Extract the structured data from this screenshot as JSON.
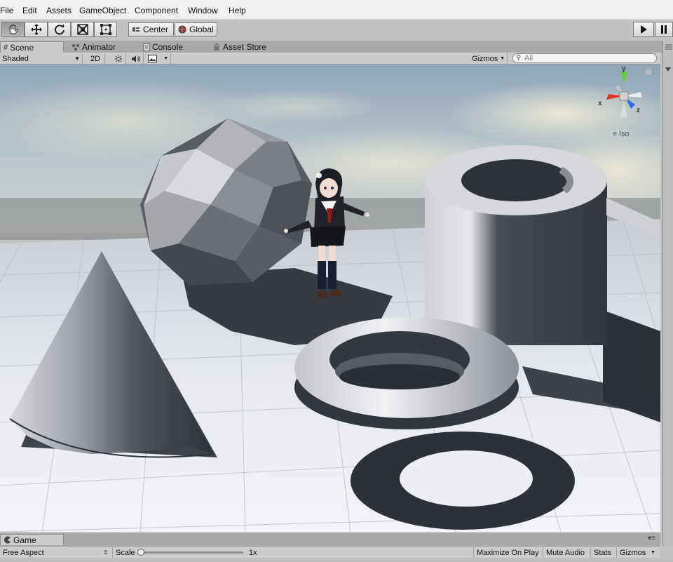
{
  "menu": [
    "File",
    "Edit",
    "Assets",
    "GameObject",
    "Component",
    "Window",
    "Help"
  ],
  "toolbar": {
    "tools": [
      "hand-tool",
      "move-tool",
      "rotate-tool",
      "scale-tool",
      "rect-tool"
    ],
    "pivot_label": "Center",
    "space_label": "Global"
  },
  "tabs": {
    "scene": "Scene",
    "animator": "Animator",
    "console": "Console",
    "asset_store": "Asset Store"
  },
  "scene_toolbar": {
    "draw_mode": "Shaded",
    "mode_2d": "2D",
    "gizmos": "Gizmos",
    "search_placeholder": "All"
  },
  "gizmo": {
    "y_label": "y",
    "x_label": "x",
    "z_label": "z",
    "projection": "Iso"
  },
  "game_panel": {
    "tab": "Game",
    "aspect": "Free Aspect",
    "scale_label": "Scale",
    "scale_value": "1x",
    "maximize": "Maximize On Play",
    "mute": "Mute Audio",
    "stats": "Stats",
    "gizmos": "Gizmos"
  },
  "colors": {
    "gizmo_x": "#e0321e",
    "gizmo_y": "#5fcf3a",
    "gizmo_z": "#2a6fe0"
  }
}
